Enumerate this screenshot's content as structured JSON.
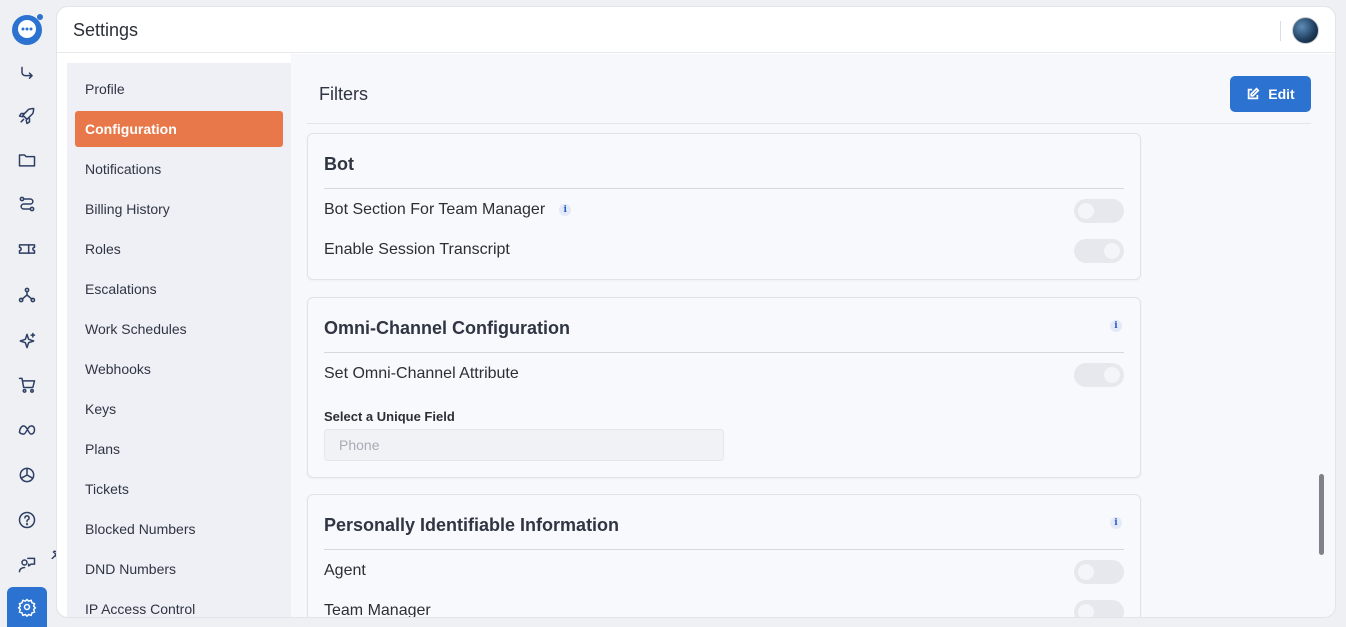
{
  "app": {
    "title": "Settings"
  },
  "rail": {
    "icons": [
      "chat-logo-icon",
      "flow-icon",
      "rocket-icon",
      "folder-icon",
      "routes-icon",
      "ticket-icon",
      "network-icon",
      "sparkle-icon",
      "cart-icon",
      "meta-icon",
      "openai-icon",
      "help-icon",
      "agent-icon",
      "settings-icon"
    ]
  },
  "sidenav": {
    "items": [
      {
        "label": "Profile"
      },
      {
        "label": "Configuration"
      },
      {
        "label": "Notifications"
      },
      {
        "label": "Billing History"
      },
      {
        "label": "Roles"
      },
      {
        "label": "Escalations"
      },
      {
        "label": "Work Schedules"
      },
      {
        "label": "Webhooks"
      },
      {
        "label": "Keys"
      },
      {
        "label": "Plans"
      },
      {
        "label": "Tickets"
      },
      {
        "label": "Blocked Numbers"
      },
      {
        "label": "DND Numbers"
      },
      {
        "label": "IP Access Control"
      }
    ],
    "selected": "Configuration"
  },
  "main": {
    "title": "Filters",
    "edit_label": "Edit",
    "cards": {
      "bot": {
        "title": "Bot",
        "rows": [
          {
            "label": "Bot Section For Team Manager",
            "enabled": false
          },
          {
            "label": "Enable Session Transcript",
            "enabled": true
          }
        ]
      },
      "omni": {
        "title": "Omni-Channel Configuration",
        "rows": [
          {
            "label": "Set Omni-Channel Attribute",
            "enabled": true
          }
        ],
        "field_label": "Select a Unique Field",
        "field_placeholder": "Phone"
      },
      "pii": {
        "title": "Personally Identifiable Information",
        "rows": [
          {
            "label": "Agent",
            "enabled": false
          },
          {
            "label": "Team Manager",
            "enabled": false
          }
        ]
      }
    }
  },
  "info_glyph": "i",
  "colors": {
    "accent": "#2b72d1",
    "selected_nav": "#e8784a"
  }
}
